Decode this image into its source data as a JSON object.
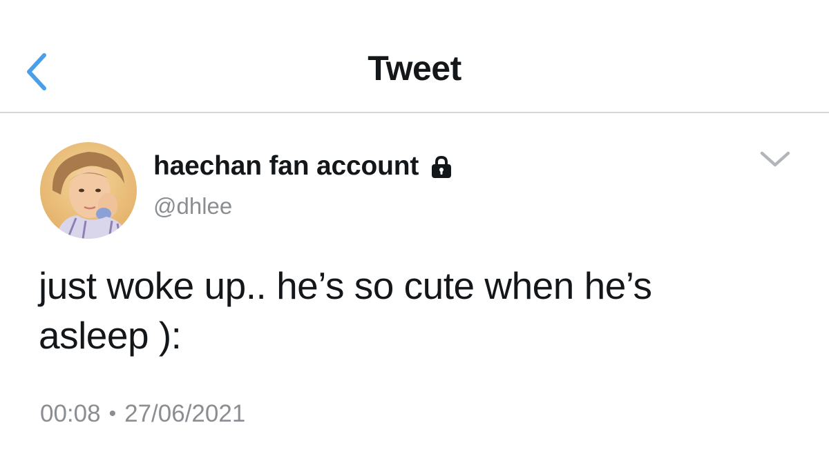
{
  "nav": {
    "back_icon": "chevron-left-icon",
    "title": "Tweet"
  },
  "tweet": {
    "author": {
      "display_name": "haechan fan account",
      "handle": "@dhlee",
      "protected_icon": "lock-icon",
      "avatar": "avatar-photo"
    },
    "more_icon": "chevron-down-icon",
    "text": "just woke up.. he’s so cute when he’s asleep ):",
    "time": "00:08",
    "separator": "•",
    "date": "27/06/2021"
  },
  "colors": {
    "accent": "#4a9fe8",
    "text_primary": "#14171a",
    "text_secondary": "#8a8d91",
    "divider": "#d3d6d8",
    "chevron": "#b2b5b9"
  }
}
